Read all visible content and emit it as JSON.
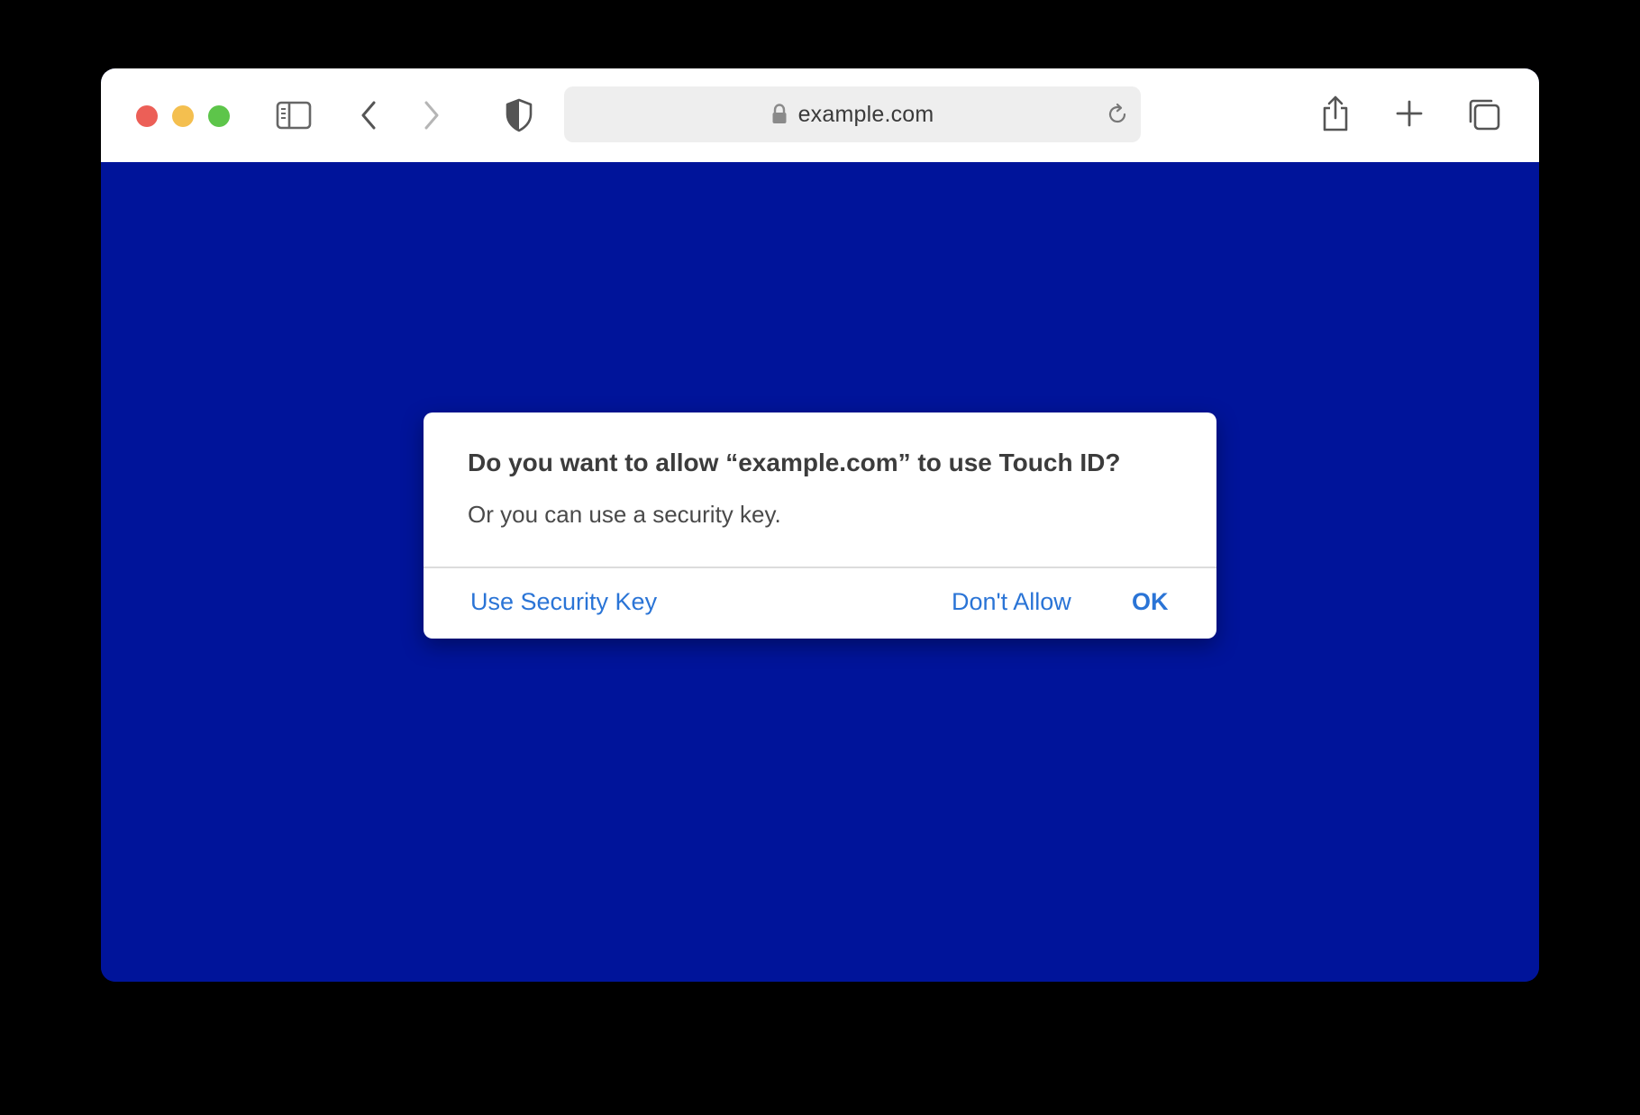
{
  "browser": {
    "address_bar": {
      "url": "example.com"
    },
    "colors": {
      "close": "#ec5f57",
      "minimize": "#f4bf4f",
      "zoom": "#5dc54a",
      "page_background": "#00149a",
      "link_blue": "#2a74d6"
    },
    "icons": {
      "sidebar": "sidebar-icon",
      "back": "chevron-left-icon",
      "forward": "chevron-right-icon",
      "privacy": "shield-icon",
      "lock": "lock-icon",
      "reload": "reload-icon",
      "share": "share-icon",
      "new_tab": "plus-icon",
      "tabs": "tabs-overview-icon"
    }
  },
  "dialog": {
    "title": "Do you want to allow “example.com” to use Touch ID?",
    "message": "Or you can use a security key.",
    "buttons": {
      "security_key": "Use Security Key",
      "dont_allow": "Don't Allow",
      "ok": "OK"
    }
  }
}
